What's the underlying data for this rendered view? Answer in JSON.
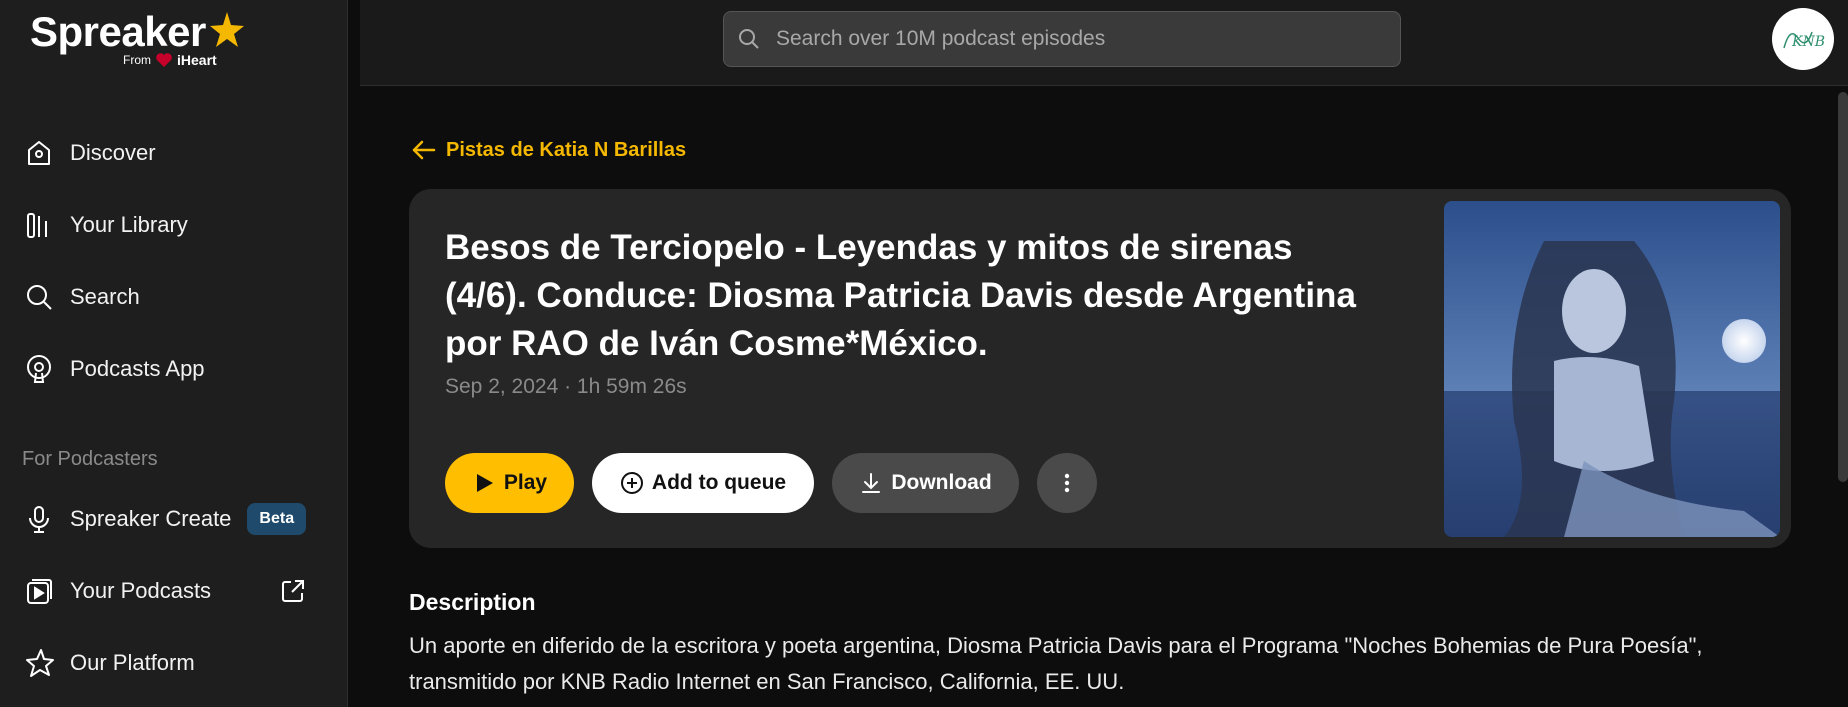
{
  "brand": {
    "name": "Spreaker",
    "from_label": "From",
    "partner": "iHeart",
    "accent_color": "#f5b800"
  },
  "search": {
    "placeholder": "Search over 10M podcast episodes"
  },
  "sidebar": {
    "items": [
      {
        "label": "Discover",
        "icon": "discover-icon"
      },
      {
        "label": "Your Library",
        "icon": "library-icon"
      },
      {
        "label": "Search",
        "icon": "search-icon"
      },
      {
        "label": "Podcasts App",
        "icon": "podcast-app-icon"
      }
    ],
    "section_label": "For Podcasters",
    "podcaster_items": [
      {
        "label": "Spreaker Create",
        "icon": "microphone-icon",
        "badge": "Beta"
      },
      {
        "label": "Your Podcasts",
        "icon": "your-podcasts-icon"
      },
      {
        "label": "Our Platform",
        "icon": "star-outline-icon"
      }
    ]
  },
  "main": {
    "back_link": "Pistas de Katia N Barillas",
    "episode": {
      "title": "Besos de Terciopelo - Leyendas y mitos de sirenas (4/6). Conduce: Diosma Patricia Davis desde Argentina por RAO de Iván Cosme*México.",
      "meta": "Sep 2, 2024 · 1h 59m 26s"
    },
    "actions": {
      "play": "Play",
      "queue": "Add to queue",
      "download": "Download"
    },
    "description": {
      "heading": "Description",
      "body": "Un aporte en diferido de la escritora y poeta argentina, Diosma Patricia Davis para el Programa \"Noches Bohemias de Pura Poesía\", transmitido por KNB Radio Internet en San Francisco, California, EE. UU."
    }
  },
  "avatar": {
    "text": "KNB"
  }
}
